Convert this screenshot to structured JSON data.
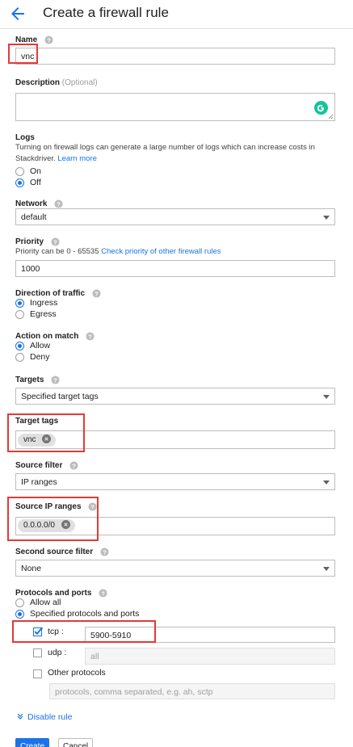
{
  "header": {
    "title": "Create a firewall rule"
  },
  "name": {
    "label": "Name",
    "value": "vnc"
  },
  "description": {
    "label": "Description",
    "optional": "(Optional)"
  },
  "logs": {
    "label": "Logs",
    "hint_line1": "Turning on firewall logs can generate a large number of logs which can increase costs in",
    "hint_line2": "Stackdriver.",
    "learn_more": "Learn more",
    "options": [
      "On",
      "Off"
    ],
    "selected": "Off"
  },
  "network": {
    "label": "Network",
    "value": "default"
  },
  "priority": {
    "label": "Priority",
    "hint": "Priority can be 0 - 65535",
    "link": "Check priority of other firewall rules",
    "value": "1000"
  },
  "direction": {
    "label": "Direction of traffic",
    "options": [
      "Ingress",
      "Egress"
    ],
    "selected": "Ingress"
  },
  "action": {
    "label": "Action on match",
    "options": [
      "Allow",
      "Deny"
    ],
    "selected": "Allow"
  },
  "targets": {
    "label": "Targets",
    "value": "Specified target tags"
  },
  "target_tags": {
    "label": "Target tags",
    "chips": [
      "vnc"
    ]
  },
  "source_filter": {
    "label": "Source filter",
    "value": "IP ranges"
  },
  "source_ip_ranges": {
    "label": "Source IP ranges",
    "chips": [
      "0.0.0.0/0"
    ]
  },
  "second_source_filter": {
    "label": "Second source filter",
    "value": "None"
  },
  "protocols": {
    "label": "Protocols and ports",
    "options": [
      "Allow all",
      "Specified protocols and ports"
    ],
    "selected": "Specified protocols and ports",
    "tcp": {
      "label": "tcp :",
      "checked": true,
      "value": "5900-5910"
    },
    "udp": {
      "label": "udp :",
      "checked": false,
      "placeholder": "all"
    },
    "other": {
      "label": "Other protocols",
      "checked": false,
      "placeholder": "protocols, comma separated, e.g. ah, sctp"
    }
  },
  "disable_rule": "Disable rule",
  "buttons": {
    "create": "Create",
    "cancel": "Cancel"
  },
  "colors": {
    "accent": "#1a73e8",
    "highlight": "#e53935",
    "grammarly": "#15c39a"
  }
}
